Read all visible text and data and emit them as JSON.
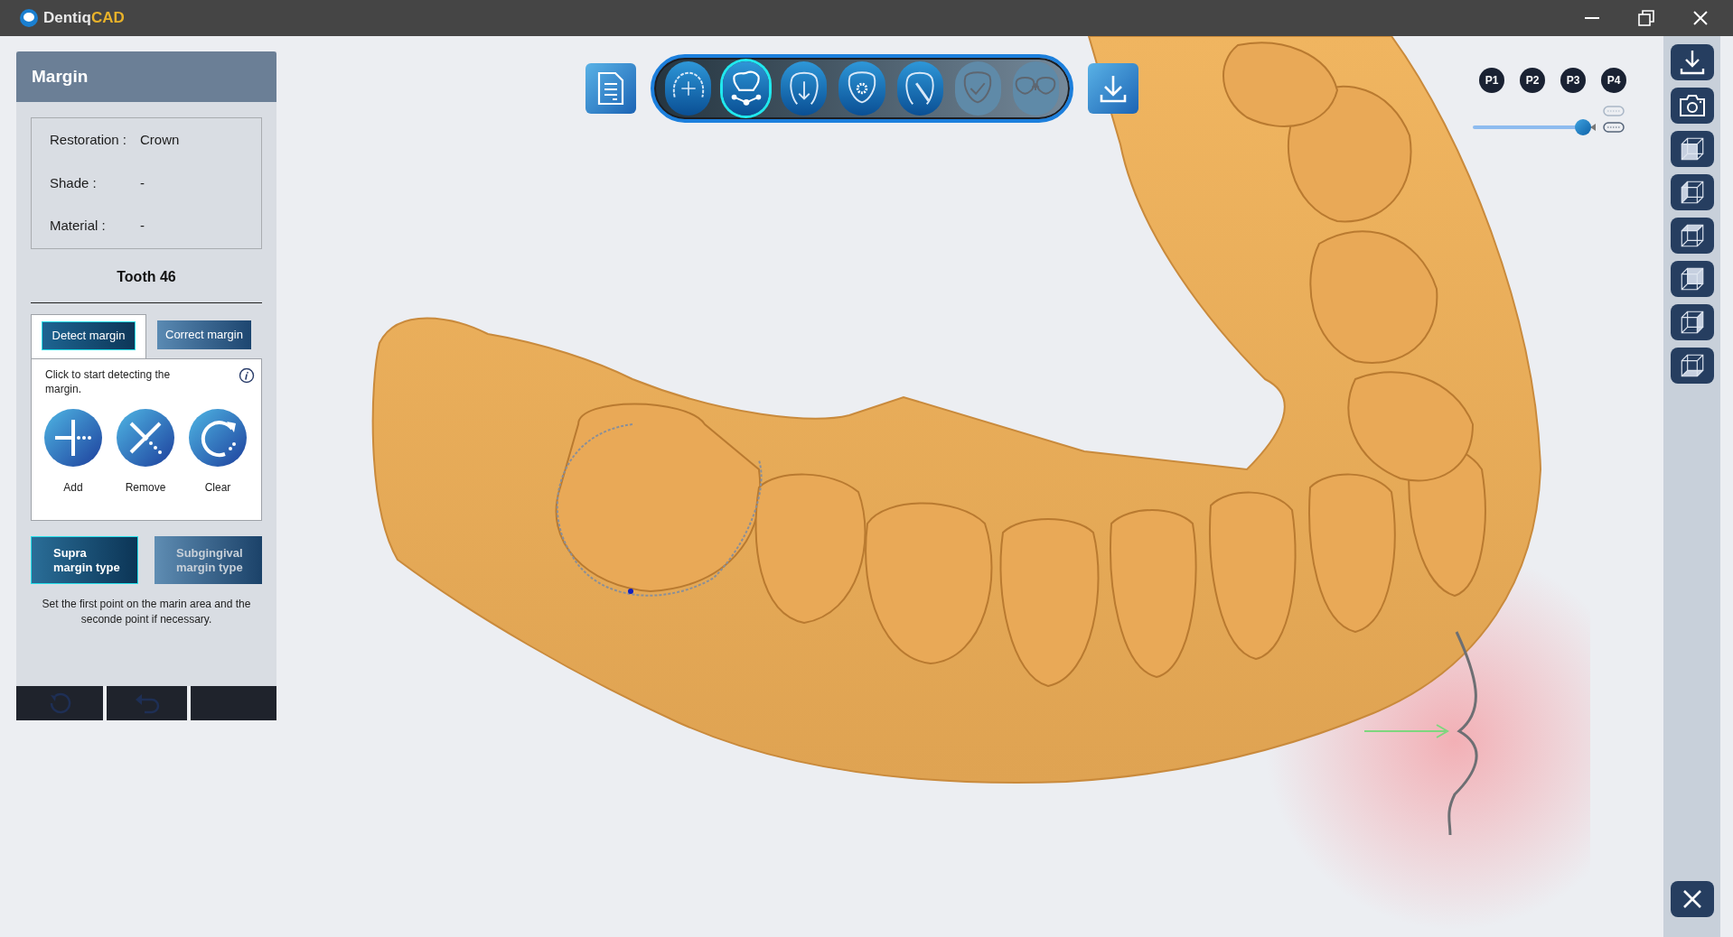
{
  "app": {
    "brand": "Dentiq",
    "brand_accent": "CAD"
  },
  "panel": {
    "title": "Margin",
    "info": [
      {
        "label": "Restoration :",
        "value": "Crown"
      },
      {
        "label": "Shade :",
        "value": "-"
      },
      {
        "label": "Material :",
        "value": "-"
      }
    ],
    "tooth": "Tooth 46",
    "tabs": [
      {
        "label": "Detect margin",
        "selected": true
      },
      {
        "label": "Correct margin",
        "selected": false
      }
    ],
    "hint": "Click to start detecting the margin.",
    "tools": [
      {
        "kind": "add",
        "label": "Add"
      },
      {
        "kind": "remove",
        "label": "Remove"
      },
      {
        "kind": "clear",
        "label": "Clear"
      }
    ],
    "margin_types": [
      {
        "label": "Supra\nmargin type",
        "selected": true
      },
      {
        "label": "Subgingival\nmargin type",
        "selected": false
      }
    ],
    "instruction": "Set the first point on the marin area and the seconde point if necessary."
  },
  "workflow_steps": [
    {
      "kind": "arch",
      "selected": false,
      "disabled": false
    },
    {
      "kind": "margin",
      "selected": true,
      "disabled": false
    },
    {
      "kind": "insertion",
      "selected": false,
      "disabled": false
    },
    {
      "kind": "settings",
      "selected": false,
      "disabled": false
    },
    {
      "kind": "design",
      "selected": false,
      "disabled": false
    },
    {
      "kind": "check",
      "selected": false,
      "disabled": true
    },
    {
      "kind": "bridge",
      "selected": false,
      "disabled": true
    }
  ],
  "presets": [
    "P1",
    "P2",
    "P3",
    "P4"
  ],
  "jaw_slider": {
    "level": 0.95
  }
}
